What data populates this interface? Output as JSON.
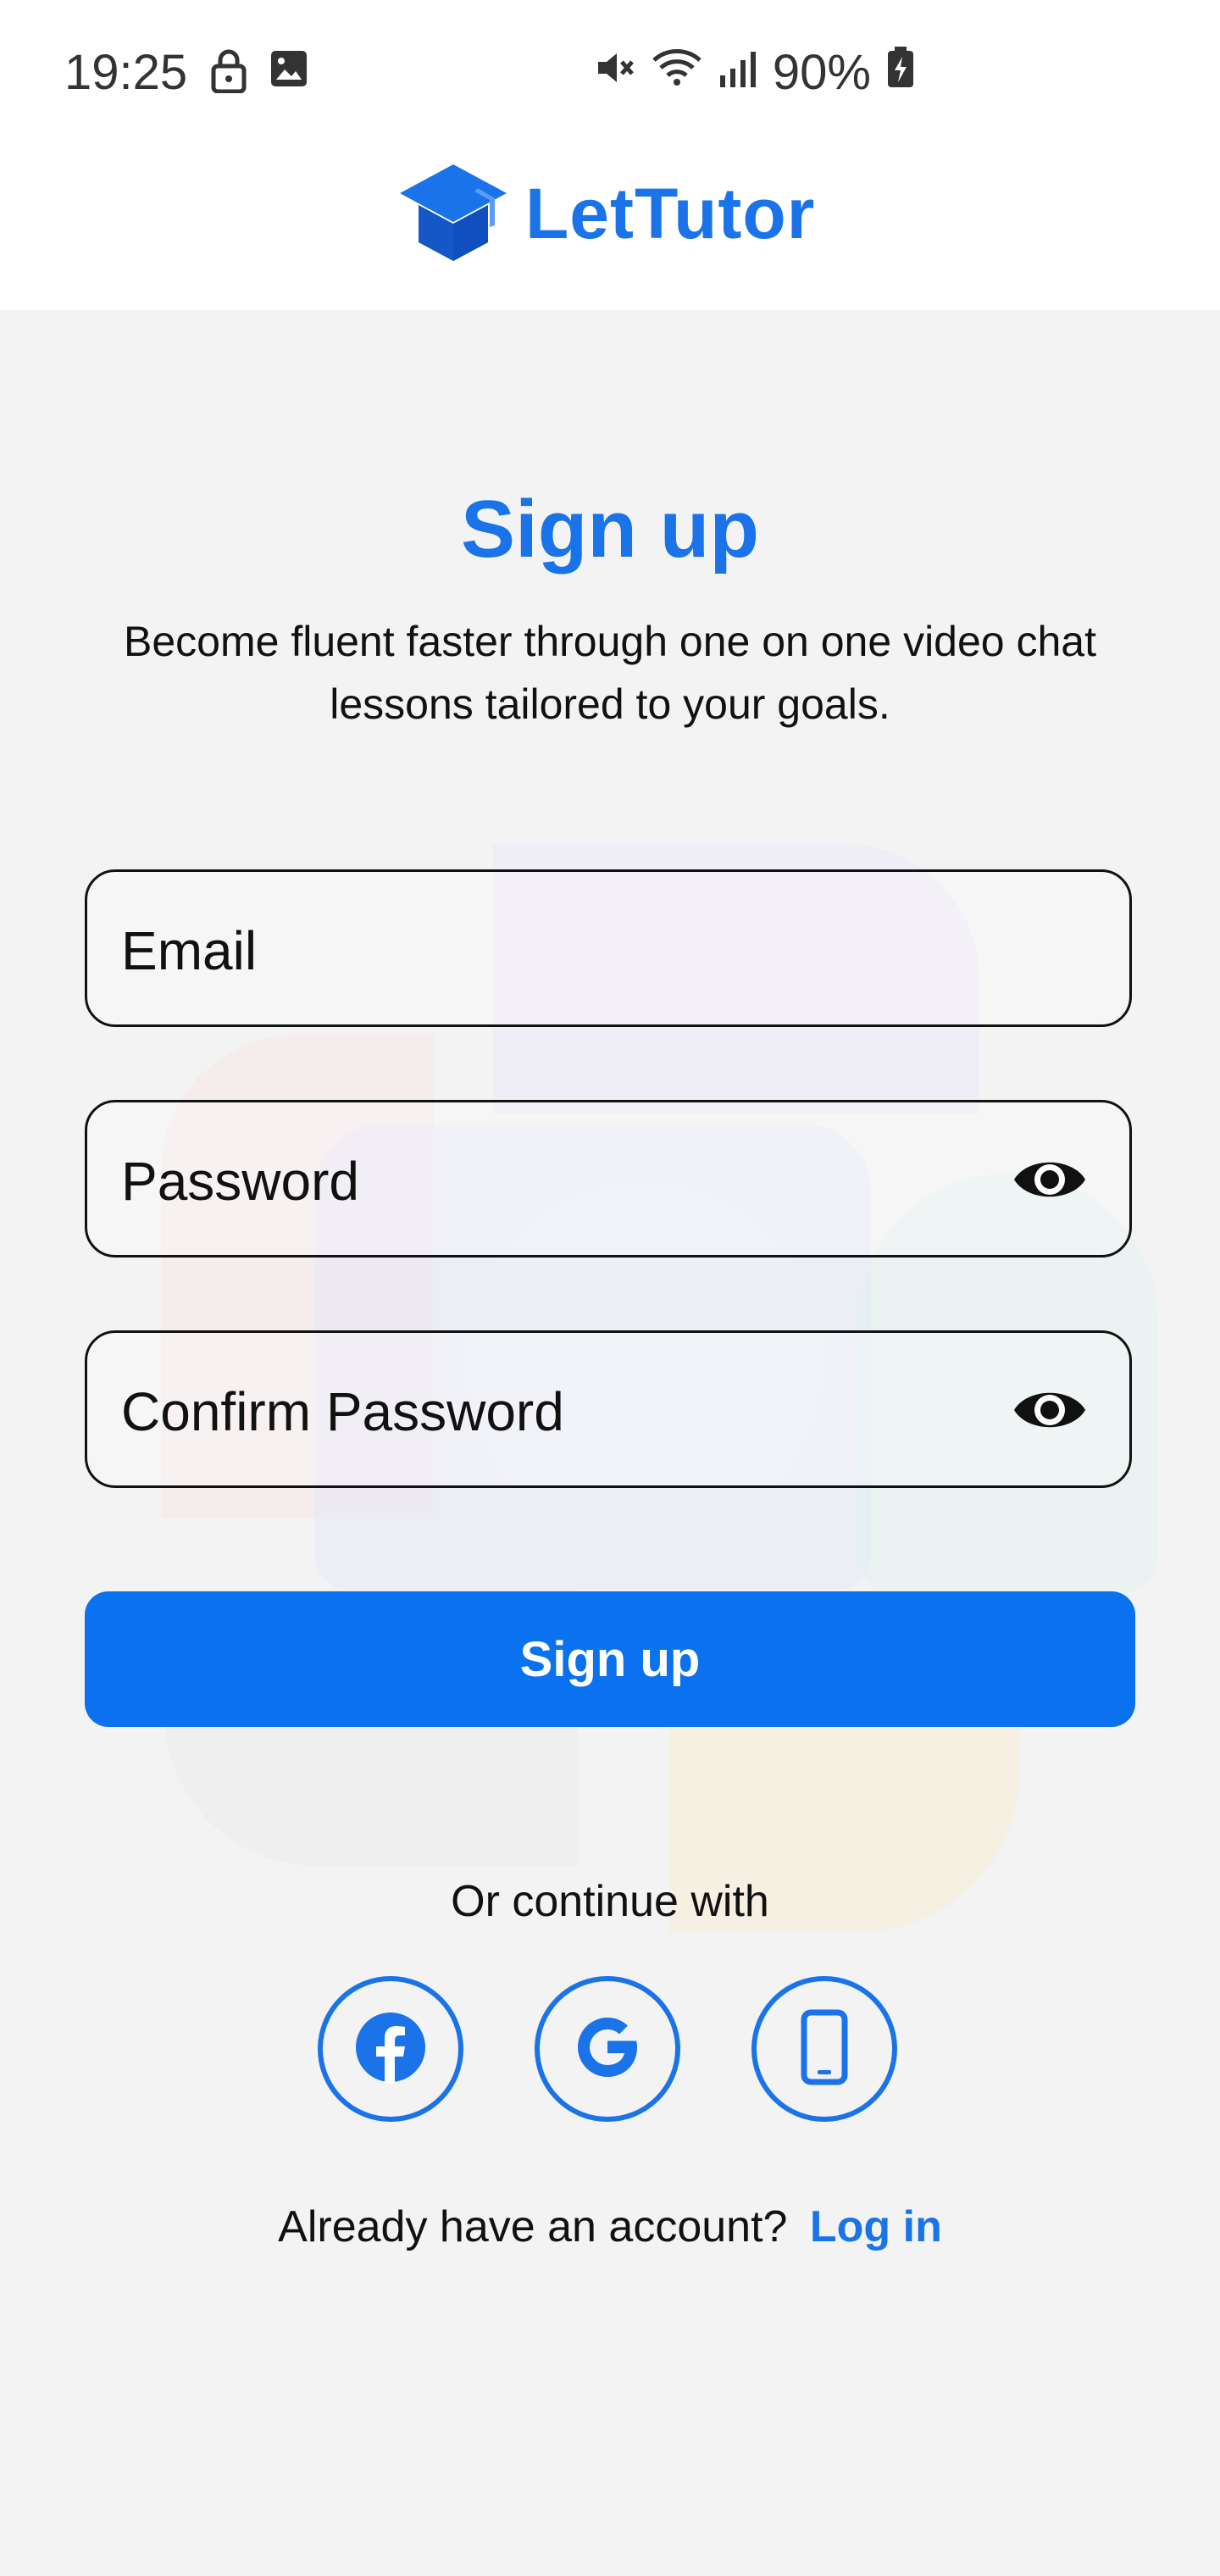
{
  "status_bar": {
    "time": "19:25",
    "battery": "90%",
    "icons": [
      "lock-icon",
      "image-icon",
      "mute-icon",
      "wifi-icon",
      "signal-icon",
      "battery-icon"
    ]
  },
  "header": {
    "brand": "LetTutor",
    "logo_icon": "graduation-cap-icon"
  },
  "main": {
    "title": "Sign up",
    "subtitle": "Become fluent faster through one on one video chat lessons tailored to your goals.",
    "fields": {
      "email": "Email",
      "password": "Password",
      "confirm_password": "Confirm Password"
    },
    "submit_label": "Sign up",
    "continue_text": "Or continue with",
    "social_icons": [
      "facebook-icon",
      "google-icon",
      "phone-icon"
    ],
    "login_prompt": "Already have an account?",
    "login_link": "Log in"
  },
  "colors": {
    "brand_blue": "#1a73e8",
    "button_blue": "#0a72ee",
    "background": "#f3f3f3"
  }
}
